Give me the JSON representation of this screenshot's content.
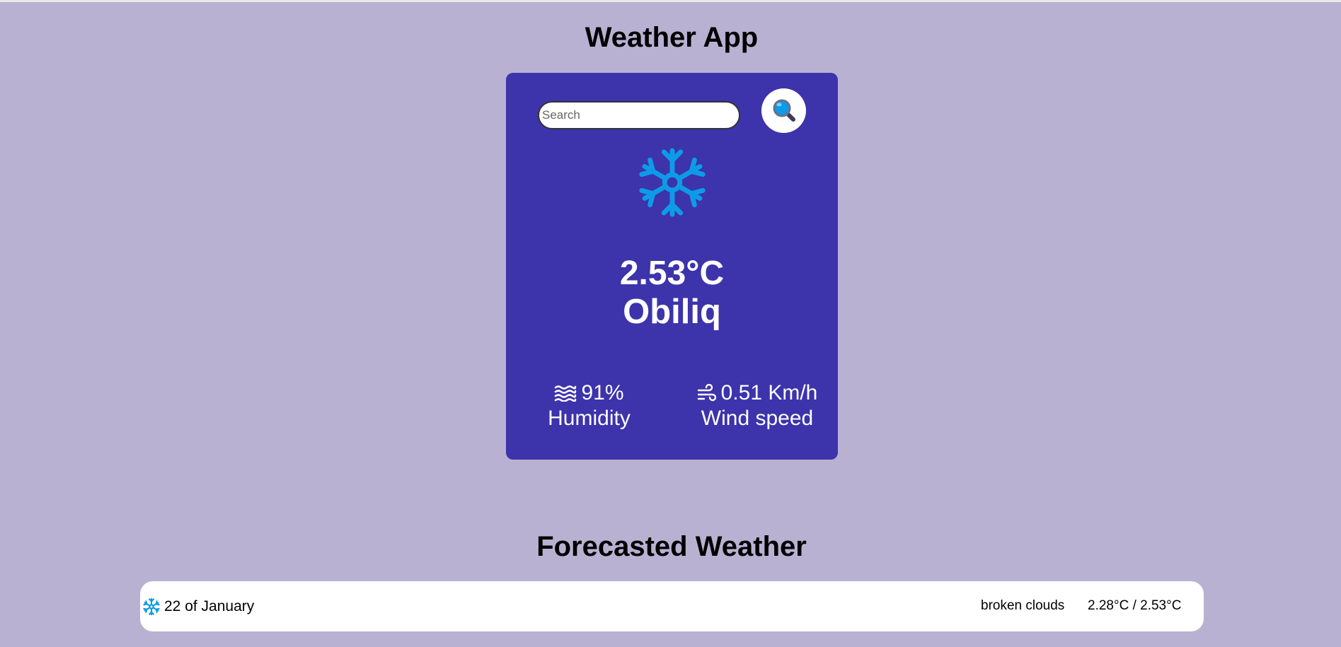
{
  "header": {
    "title": "Weather App"
  },
  "search": {
    "placeholder": "Search",
    "value": "",
    "button_icon": "search-icon"
  },
  "current": {
    "icon": "snowflake-icon",
    "temperature": "2.53°C",
    "city": "Obiliq",
    "humidity": {
      "icon": "humidity-waves-icon",
      "value": "91%",
      "label": "Humidity"
    },
    "wind": {
      "icon": "wind-icon",
      "value": "0.51 Km/h",
      "label": "Wind speed"
    }
  },
  "forecast": {
    "title": "Forecasted Weather",
    "items": [
      {
        "icon": "snowflake-icon",
        "date": "22 of January",
        "description": "broken clouds",
        "temps": "2.28°C / 2.53°C"
      }
    ]
  },
  "colors": {
    "page_background": "#b9b1d2",
    "card_background": "#3d33ab",
    "icon_blue": "#0d9be8",
    "text_light": "#ffffff",
    "text_dark": "#000000"
  }
}
